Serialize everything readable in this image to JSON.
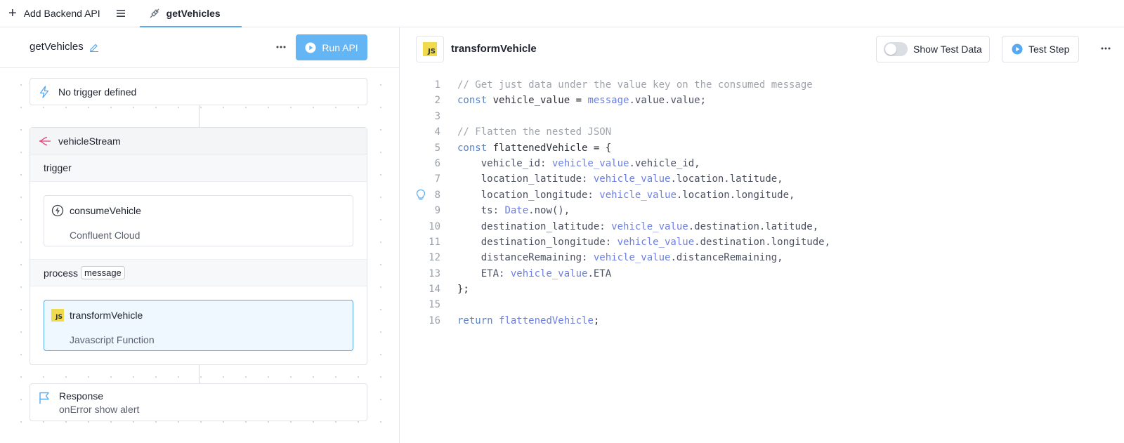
{
  "topbar": {
    "add_api_label": "Add Backend API",
    "tab_label": "getVehicles"
  },
  "left": {
    "api_name": "getVehicles",
    "run_label": "Run API",
    "trigger_text": "No trigger defined",
    "stream_name": "vehicleStream",
    "trigger_section": "trigger",
    "consume_step": {
      "title": "consumeVehicle",
      "subtitle": "Confluent Cloud"
    },
    "process_label": "process",
    "process_tag": "message",
    "transform_step": {
      "title": "transformVehicle",
      "subtitle": "Javascript Function"
    },
    "response": {
      "title": "Response",
      "subtitle": "onError show alert"
    }
  },
  "right": {
    "step_title": "transformVehicle",
    "js_badge": "JS",
    "show_test_data_label": "Show Test Data",
    "test_step_label": "Test Step",
    "show_test_data_on": false
  },
  "code": {
    "lines": [
      [
        {
          "t": "// Get just data under the value key on the consumed message",
          "c": "comment"
        }
      ],
      [
        {
          "t": "const",
          "c": "kw"
        },
        {
          "t": " vehicle_value = "
        },
        {
          "t": "message",
          "c": "ref"
        },
        {
          "t": ".value.value;",
          "c": "prop"
        }
      ],
      [],
      [
        {
          "t": "// Flatten the nested JSON",
          "c": "comment"
        }
      ],
      [
        {
          "t": "const",
          "c": "kw"
        },
        {
          "t": " flattenedVehicle = {"
        }
      ],
      [
        {
          "t": "    vehicle_id: ",
          "c": "prop"
        },
        {
          "t": "vehicle_value",
          "c": "ref"
        },
        {
          "t": ".vehicle_id,",
          "c": "prop"
        }
      ],
      [
        {
          "t": "    location_latitude: ",
          "c": "prop"
        },
        {
          "t": "vehicle_value",
          "c": "ref"
        },
        {
          "t": ".location.latitude,",
          "c": "prop"
        }
      ],
      [
        {
          "t": "    location_longitude: ",
          "c": "prop"
        },
        {
          "t": "vehicle_value",
          "c": "ref"
        },
        {
          "t": ".location.longitude,",
          "c": "prop"
        }
      ],
      [
        {
          "t": "    ts: ",
          "c": "prop"
        },
        {
          "t": "Date",
          "c": "ref"
        },
        {
          "t": ".now(),",
          "c": "prop"
        }
      ],
      [
        {
          "t": "    destination_latitude: ",
          "c": "prop"
        },
        {
          "t": "vehicle_value",
          "c": "ref"
        },
        {
          "t": ".destination.latitude,",
          "c": "prop"
        }
      ],
      [
        {
          "t": "    destination_longitude: ",
          "c": "prop"
        },
        {
          "t": "vehicle_value",
          "c": "ref"
        },
        {
          "t": ".destination.longitude,",
          "c": "prop"
        }
      ],
      [
        {
          "t": "    distanceRemaining: ",
          "c": "prop"
        },
        {
          "t": "vehicle_value",
          "c": "ref"
        },
        {
          "t": ".distanceRemaining,",
          "c": "prop"
        }
      ],
      [
        {
          "t": "    ETA: ",
          "c": "prop"
        },
        {
          "t": "vehicle_value",
          "c": "ref"
        },
        {
          "t": ".ETA",
          "c": "prop"
        }
      ],
      [
        {
          "t": "};"
        }
      ],
      [],
      [
        {
          "t": "return",
          "c": "kw"
        },
        {
          "t": " "
        },
        {
          "t": "flattenedVehicle",
          "c": "ref"
        },
        {
          "t": ";"
        }
      ]
    ],
    "lightbulb_line": 8
  },
  "colors": {
    "accent": "#56a9ef",
    "run_button": "#63b5f4",
    "js_yellow": "#f0db4f",
    "stream_icon": "#e8417a"
  }
}
